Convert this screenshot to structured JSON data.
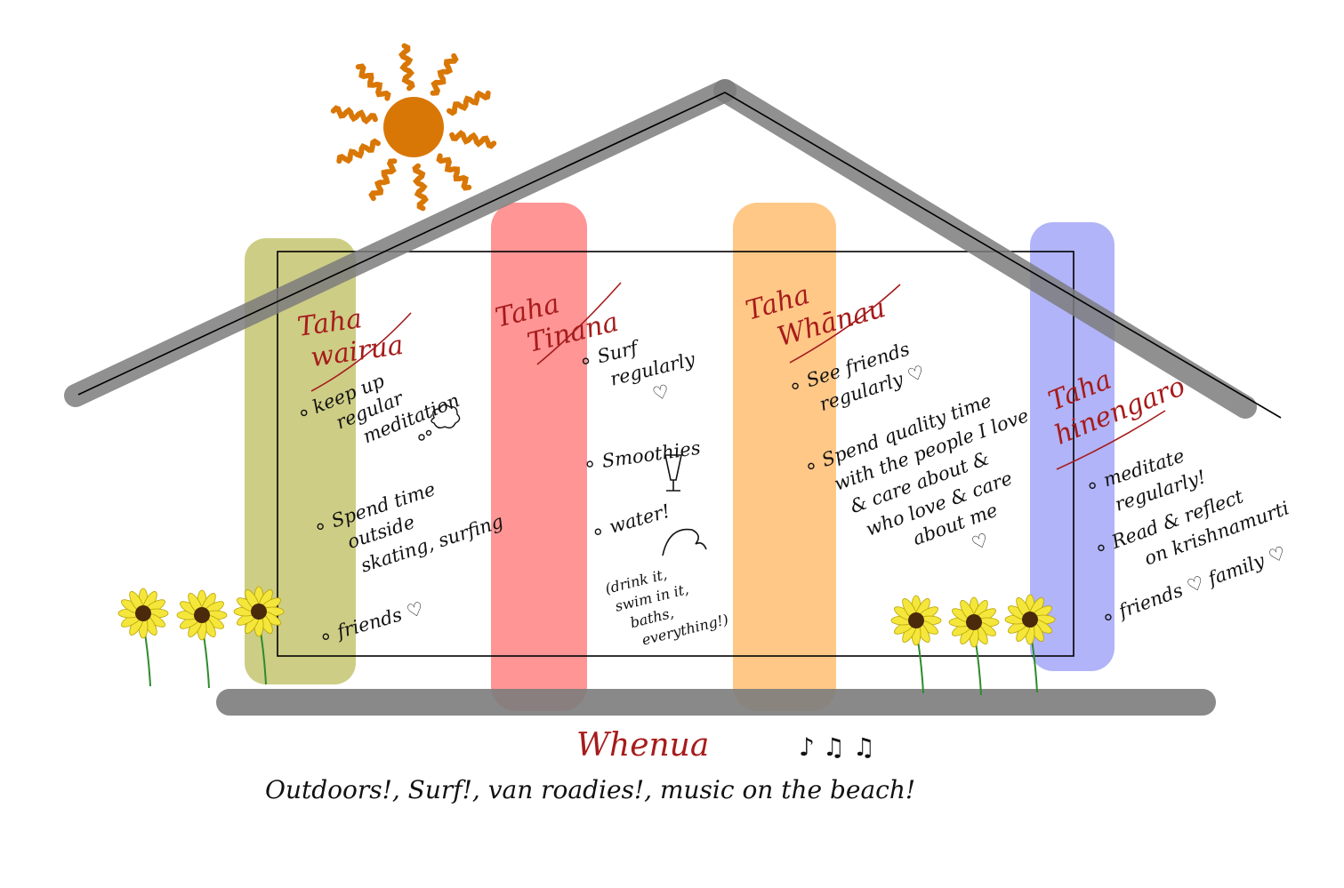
{
  "pillars": [
    {
      "heading_line1": "Taha",
      "heading_line2": "wairua",
      "color": "#c8c878",
      "items": [
        [
          "keep up",
          "regular",
          "meditation"
        ],
        [
          "Spend time",
          "outside",
          "skating, surfing"
        ],
        [
          "friends ♡"
        ]
      ]
    },
    {
      "heading_line1": "Taha",
      "heading_line2": "Tinana",
      "color": "#ff8a8a",
      "items": [
        [
          "Surf",
          "regularly",
          "♡"
        ],
        [
          "Smoothies"
        ],
        [
          "water!"
        ]
      ],
      "note_lines": [
        "(drink it,",
        "swim in it,",
        "baths,",
        "everything!)"
      ]
    },
    {
      "heading_line1": "Taha",
      "heading_line2": "Whānau",
      "color": "#ffc27a",
      "items": [
        [
          "See friends",
          "regularly ♡"
        ],
        [
          "Spend quality time",
          "with the people I love",
          "& care about &",
          "who love & care",
          "about me",
          "♡"
        ]
      ]
    },
    {
      "heading_line1": "Taha",
      "heading_line2": "hinengaro",
      "color": "#a8acf7",
      "items": [
        [
          "meditate",
          "regularly!"
        ],
        [
          "Read & reflect",
          "on krishnamurti"
        ],
        [
          "friends ♡ family ♡"
        ]
      ]
    }
  ],
  "foundation": {
    "title": "Whenua",
    "notes": "♪ ♫ ♫",
    "text": "Outdoors!, Surf!,  van roadies!, music on the beach!"
  },
  "colors": {
    "roof": "#7d7d7d",
    "sun": "#d97706",
    "sunflower_petal": "#f5e63c",
    "sunflower_center": "#4a2a0a",
    "stem": "#2e8b2e"
  }
}
